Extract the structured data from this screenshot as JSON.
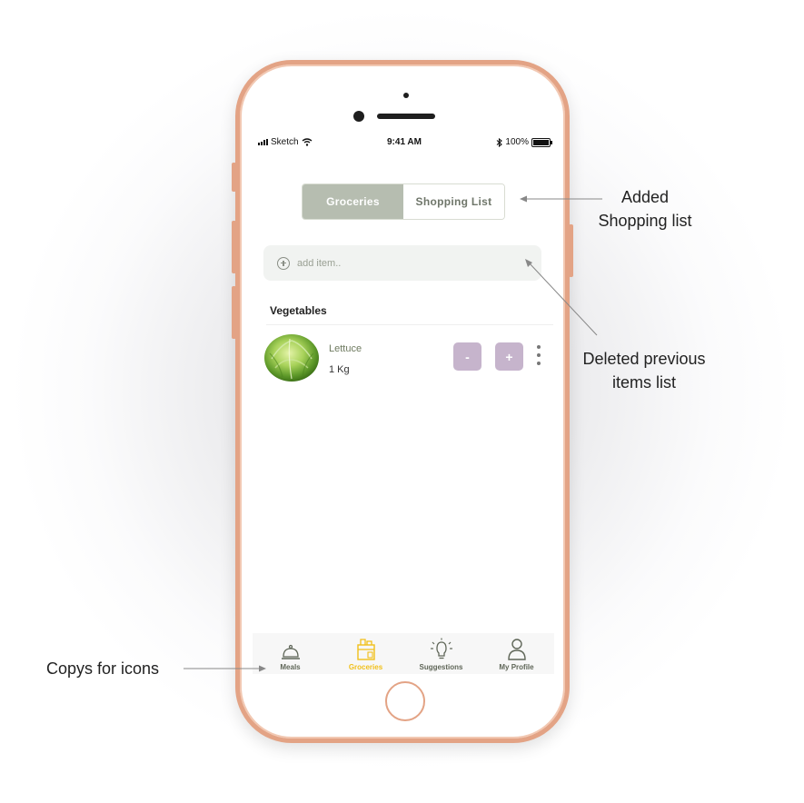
{
  "status_bar": {
    "carrier": "Sketch",
    "time": "9:41 AM",
    "battery": "100%"
  },
  "segmented_control": {
    "tabs": [
      {
        "label": "Groceries",
        "active": true
      },
      {
        "label": "Shopping List",
        "active": false
      }
    ]
  },
  "add_item": {
    "placeholder": "add item.."
  },
  "section": {
    "title": "Vegetables",
    "items": [
      {
        "name": "Lettuce",
        "quantity": "1 Kg",
        "decrement_label": "-",
        "increment_label": "+"
      }
    ]
  },
  "tab_bar": {
    "tabs": [
      {
        "label": "Meals",
        "icon": "cloche-icon",
        "active": false
      },
      {
        "label": "Groceries",
        "icon": "grocery-bag-icon",
        "active": true
      },
      {
        "label": "Suggestions",
        "icon": "lightbulb-icon",
        "active": false
      },
      {
        "label": "My Profile",
        "icon": "person-icon",
        "active": false
      }
    ]
  },
  "annotations": {
    "shopping_list": {
      "line1": "Added",
      "line2": "Shopping list"
    },
    "deleted_items": {
      "line1": "Deleted previous",
      "line2": "items list"
    },
    "icon_copies": "Copys for icons"
  },
  "colors": {
    "phone_frame": "#e3a385",
    "segment_active": "#b6bdb0",
    "qty_button": "#c6b4cc",
    "tab_active": "#f1c01a"
  }
}
